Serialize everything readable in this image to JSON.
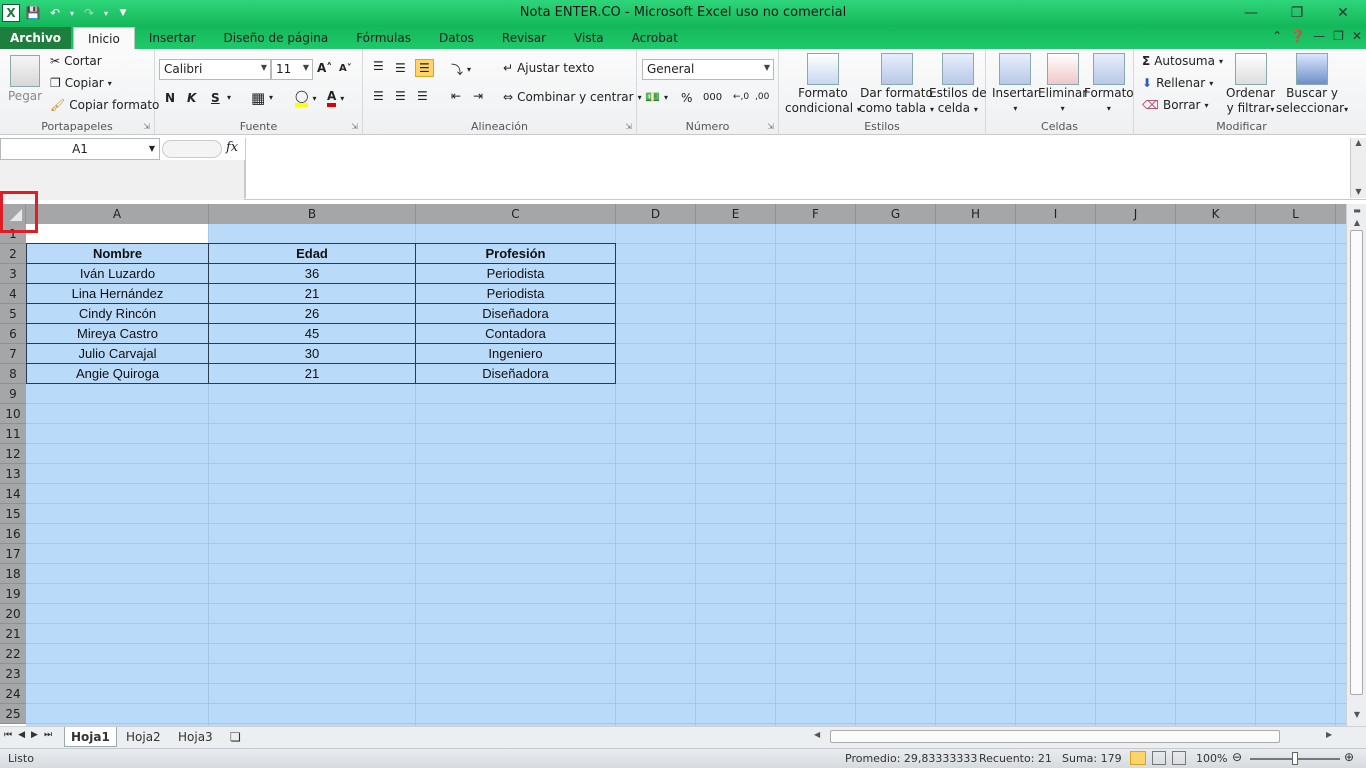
{
  "window": {
    "title": "Nota ENTER.CO  -  Microsoft Excel uso no comercial"
  },
  "ribbon_tabs": [
    {
      "label": "Archivo"
    },
    {
      "label": "Inicio"
    },
    {
      "label": "Insertar"
    },
    {
      "label": "Diseño de página"
    },
    {
      "label": "Fórmulas"
    },
    {
      "label": "Datos"
    },
    {
      "label": "Revisar"
    },
    {
      "label": "Vista"
    },
    {
      "label": "Acrobat"
    }
  ],
  "ribbon": {
    "portapapeles": {
      "label": "Portapapeles",
      "paste": "Pegar",
      "cut": "Cortar",
      "copy": "Copiar",
      "format_painter": "Copiar formato"
    },
    "fuente": {
      "label": "Fuente",
      "font": "Calibri",
      "size": "11",
      "bold": "N",
      "italic": "K",
      "underline": "S"
    },
    "alineacion": {
      "label": "Alineación",
      "wrap": "Ajustar texto",
      "merge": "Combinar y centrar"
    },
    "numero": {
      "label": "Número",
      "format": "General"
    },
    "estilos": {
      "label": "Estilos",
      "cond_1": "Formato",
      "cond_2": "condicional",
      "table_1": "Dar formato",
      "table_2": "como tabla",
      "cell_1": "Estilos de",
      "cell_2": "celda"
    },
    "celdas": {
      "label": "Celdas",
      "insert": "Insertar",
      "delete": "Eliminar",
      "format": "Formato"
    },
    "modificar": {
      "label": "Modificar",
      "autosum": "Autosuma",
      "fill": "Rellenar",
      "clear": "Borrar",
      "sort_1": "Ordenar",
      "sort_2": "y filtrar",
      "find_1": "Buscar y",
      "find_2": "seleccionar"
    }
  },
  "formula_bar": {
    "name_box": "A1",
    "fx": "fx",
    "value": ""
  },
  "columns": [
    "A",
    "B",
    "C",
    "D",
    "E",
    "F",
    "G",
    "H",
    "I",
    "J",
    "K",
    "L"
  ],
  "rows": [
    "1",
    "2",
    "3",
    "4",
    "5",
    "6",
    "7",
    "8",
    "9",
    "10",
    "11",
    "12",
    "13",
    "14",
    "15",
    "16",
    "17",
    "18",
    "19",
    "20",
    "21",
    "22",
    "23",
    "24",
    "25"
  ],
  "table": {
    "headers": [
      "Nombre",
      "Edad",
      "Profesión"
    ],
    "rows": [
      [
        "Iván Luzardo",
        "36",
        "Periodista"
      ],
      [
        "Lina Hernández",
        "21",
        "Periodista"
      ],
      [
        "Cindy Rincón",
        "26",
        "Diseñadora"
      ],
      [
        "Mireya Castro",
        "45",
        "Contadora"
      ],
      [
        "Julio Carvajal",
        "30",
        "Ingeniero"
      ],
      [
        "Angie Quiroga",
        "21",
        "Diseñadora"
      ]
    ]
  },
  "sheets": [
    {
      "name": "Hoja1"
    },
    {
      "name": "Hoja2"
    },
    {
      "name": "Hoja3"
    }
  ],
  "status": {
    "ready": "Listo",
    "average": "Promedio: 29,83333333",
    "count": "Recuento: 21",
    "sum": "Suma: 179",
    "zoom": "100%"
  }
}
